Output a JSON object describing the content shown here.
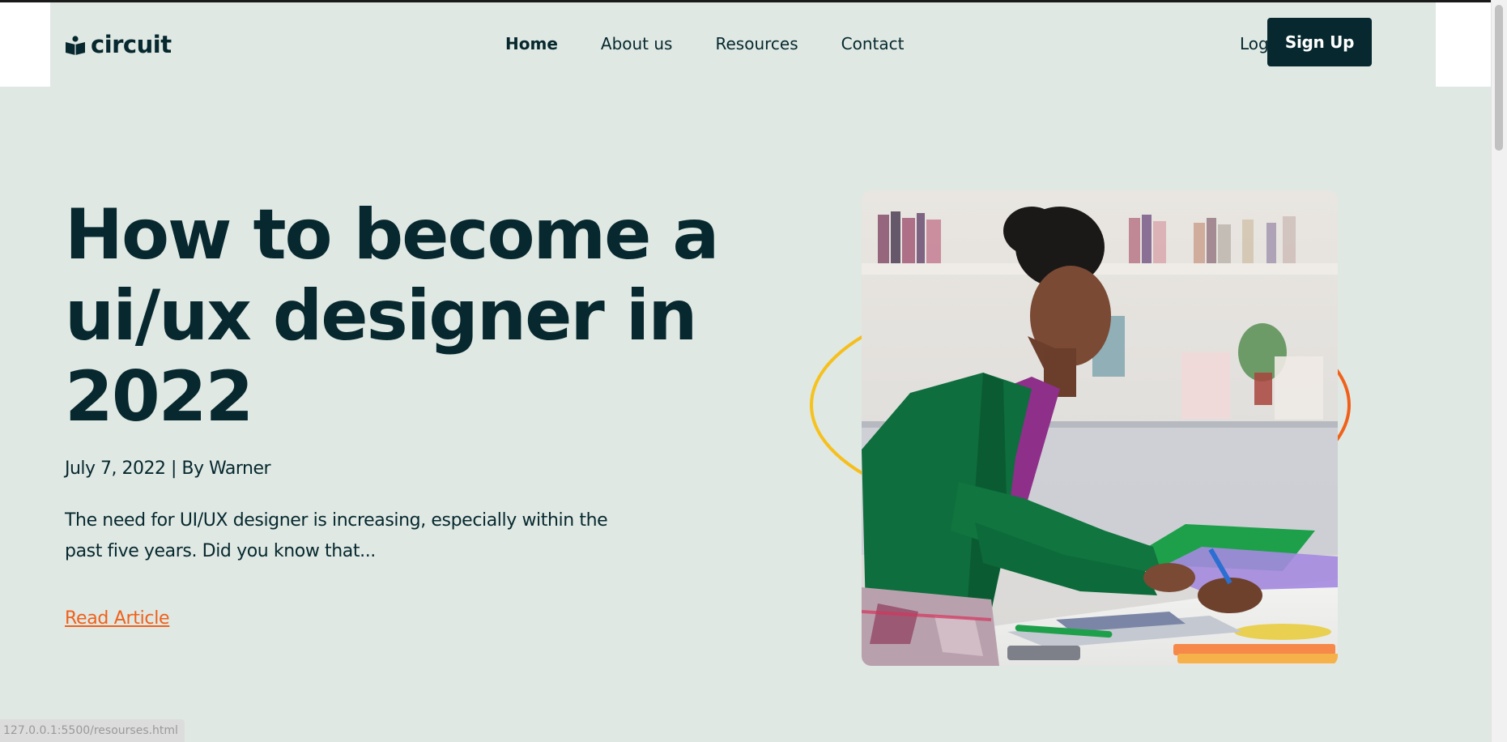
{
  "brand": {
    "name": "circuit",
    "icon": "book-icon"
  },
  "nav": {
    "items": [
      {
        "label": "Home",
        "active": true
      },
      {
        "label": "About us",
        "active": false
      },
      {
        "label": "Resources",
        "active": false
      },
      {
        "label": "Contact",
        "active": false
      }
    ],
    "login_label": "Log In",
    "signup_label": "Sign Up"
  },
  "hero": {
    "title": "How to become a ui/ux designer in 2022",
    "meta": "July 7, 2022 | By Warner",
    "excerpt": "The need for UI/UX designer is increasing, especially within the past five years. Did you know that...",
    "cta_label": "Read Article"
  },
  "status_bar": {
    "url": "127.0.0.1:5500/resourses.html"
  },
  "colors": {
    "background": "#dfe8e3",
    "text": "#06282e",
    "accent_orange": "#f0601a",
    "ring_yellow": "#f6c21c",
    "button_dark": "#06282e"
  }
}
